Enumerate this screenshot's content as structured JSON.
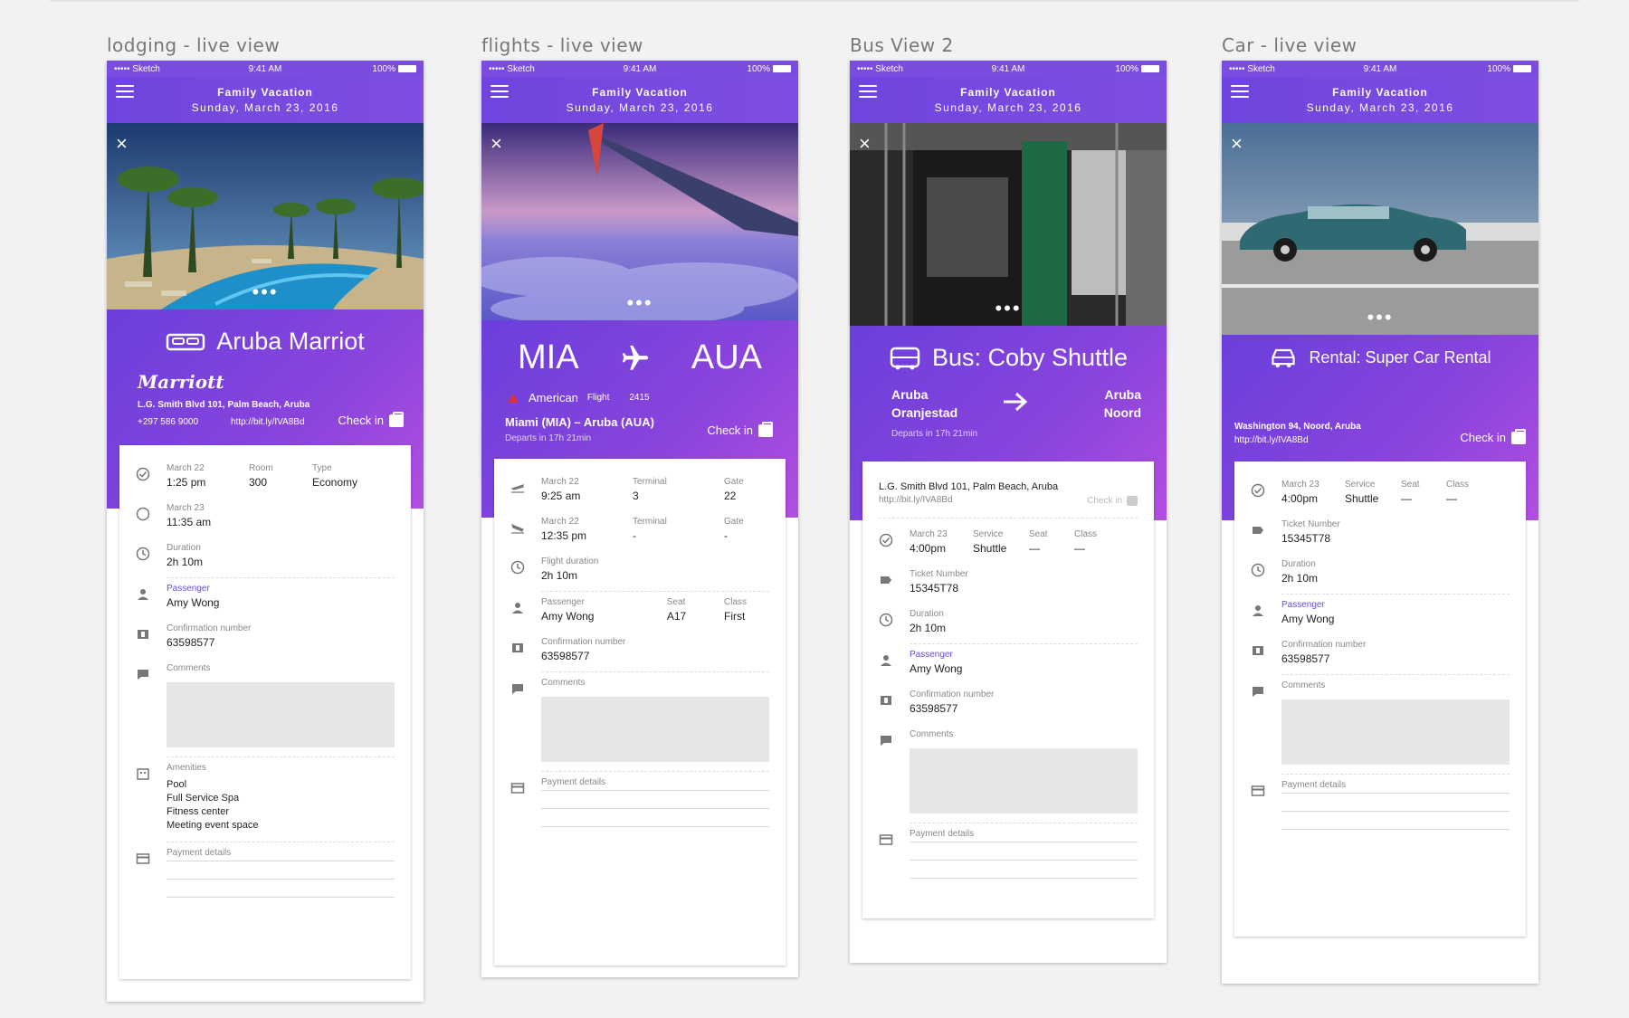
{
  "shared": {
    "status_carrier": "••••• Sketch",
    "status_time": "9:41 AM",
    "status_battery": "100%",
    "trip_title": "Family Vacation",
    "trip_date": "Sunday, March 23, 2016",
    "close_glyph": "×",
    "more_glyph": "•••"
  },
  "lodging": {
    "board_title": "lodging - live view",
    "name": "Aruba Marriot",
    "brand": "Marriott",
    "address": "L.G. Smith Blvd 101, Palm Beach, Aruba",
    "phone": "+297 586 9000",
    "url": "http://bit.ly/IVA8Bd",
    "checkin": "Check in",
    "checkin_date": "March 22",
    "checkin_time": "1:25 pm",
    "room_label": "Room",
    "room_value": "300",
    "type_label": "Type",
    "type_value": "Economy",
    "checkout_date": "March 23",
    "checkout_time": "11:35 am",
    "duration_label": "Duration",
    "duration_value": "2h 10m",
    "passenger_label": "Passenger",
    "passenger_value": "Amy Wong",
    "confirmation_label": "Confirmation number",
    "confirmation_value": "63598577",
    "comments_label": "Comments",
    "amenities_label": "Amenities",
    "amenities": [
      "Pool",
      "Full Service Spa",
      "Fitness center",
      "Meeting event space"
    ],
    "payment_label": "Payment details"
  },
  "flight": {
    "board_title": "flights - live view",
    "from_code": "MIA",
    "to_code": "AUA",
    "airline": "American",
    "flight_label": "Flight",
    "flight_number": "2415",
    "route": "Miami (MIA) – Aruba (AUA)",
    "departs": "Departs in 17h 21min",
    "checkin": "Check in",
    "dep_date": "March 22",
    "dep_time": "9:25 am",
    "terminal_label": "Terminal",
    "dep_terminal": "3",
    "gate_label": "Gate",
    "dep_gate": "22",
    "arr_date": "March 22",
    "arr_time": "12:35 pm",
    "arr_terminal": "-",
    "arr_gate": "-",
    "flight_duration_label": "Flight duration",
    "flight_duration_value": "2h 10m",
    "passenger_label": "Passenger",
    "passenger_value": "Amy Wong",
    "seat_label": "Seat",
    "seat_value": "A17",
    "class_label": "Class",
    "class_value": "First",
    "confirmation_label": "Confirmation number",
    "confirmation_value": "63598577",
    "comments_label": "Comments",
    "payment_label": "Payment details"
  },
  "bus": {
    "board_title": "Bus View 2",
    "title": "Bus: Coby Shuttle",
    "from_place": "Aruba Oranjestad",
    "to_place": "Aruba Noord",
    "departs": "Departs in 17h 21min",
    "address": "L.G. Smith Blvd 101, Palm Beach, Aruba",
    "url": "http://bit.ly/IVA8Bd",
    "checkin": "Check in",
    "date": "March 23",
    "time": "4:00pm",
    "service_label": "Service",
    "service_value": "Shuttle",
    "seat_label": "Seat",
    "seat_value": "—",
    "class_label": "Class",
    "class_value": "—",
    "ticket_label": "Ticket Number",
    "ticket_value": "15345T78",
    "duration_label": "Duration",
    "duration_value": "2h 10m",
    "passenger_label": "Passenger",
    "passenger_value": "Amy Wong",
    "confirmation_label": "Confirmation number",
    "confirmation_value": "63598577",
    "comments_label": "Comments",
    "payment_label": "Payment details"
  },
  "car": {
    "board_title": "Car - live view",
    "title": "Rental: Super Car Rental",
    "address": "Washington 94, Noord, Aruba",
    "url": "http://bit.ly/IVA8Bd",
    "checkin": "Check in",
    "date": "March 23",
    "time": "4:00pm",
    "service_label": "Service",
    "service_value": "Shuttle",
    "seat_label": "Seat",
    "seat_value": "—",
    "class_label": "Class",
    "class_value": "—",
    "ticket_label": "Ticket Number",
    "ticket_value": "15345T78",
    "duration_label": "Duration",
    "duration_value": "2h 10m",
    "passenger_label": "Passenger",
    "passenger_value": "Amy Wong",
    "confirmation_label": "Confirmation number",
    "confirmation_value": "63598577",
    "comments_label": "Comments",
    "payment_label": "Payment details"
  }
}
